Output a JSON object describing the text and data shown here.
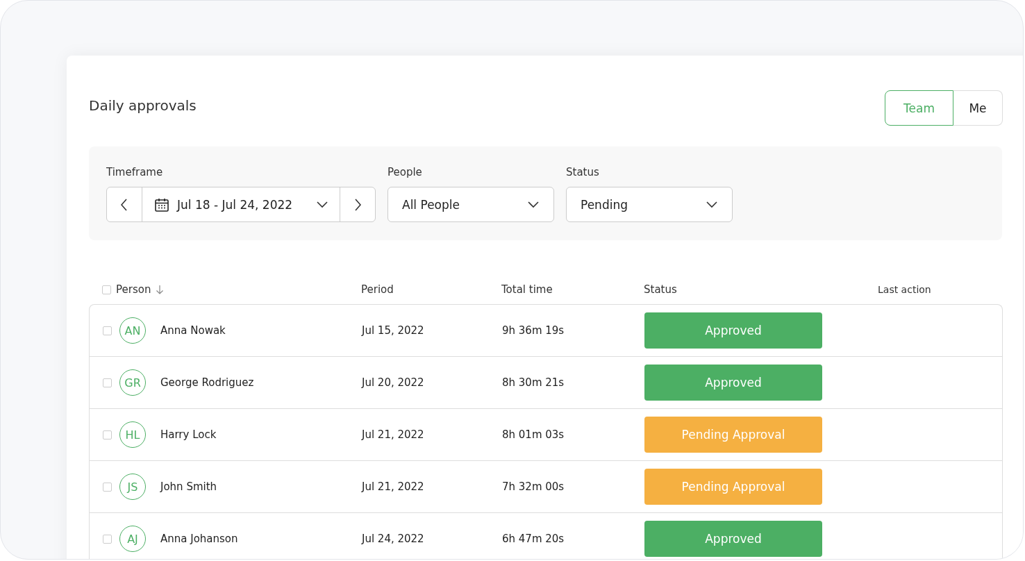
{
  "title": "Daily approvals",
  "view_toggle": [
    {
      "label": "Team",
      "selected": true
    },
    {
      "label": "Me",
      "selected": false
    }
  ],
  "filters": {
    "timeframe": {
      "label": "Timeframe",
      "value": "Jul 18 - Jul 24, 2022"
    },
    "people": {
      "label": "People",
      "value": "All People"
    },
    "status": {
      "label": "Status",
      "value": "Pending"
    }
  },
  "table": {
    "select_all_checked": false,
    "columns": [
      "Person",
      "Period",
      "Total time",
      "Status",
      "Last action"
    ],
    "rows": [
      {
        "checked": false,
        "initials": "AN",
        "person": "Anna Nowak",
        "period": "Jul 15, 2022",
        "total_time": "9h 36m 19s",
        "status": {
          "kind": "approved",
          "label": "Approved"
        }
      },
      {
        "checked": false,
        "initials": "GR",
        "person": "George Rodriguez",
        "period": "Jul 20, 2022",
        "total_time": "8h 30m 21s",
        "status": {
          "kind": "approved",
          "label": "Approved"
        }
      },
      {
        "checked": false,
        "initials": "HL",
        "person": "Harry Lock",
        "period": "Jul 21, 2022",
        "total_time": "8h 01m 03s",
        "status": {
          "kind": "pending",
          "label": "Pending Approval"
        }
      },
      {
        "checked": false,
        "initials": "JS",
        "person": "John Smith",
        "period": "Jul 21, 2022",
        "total_time": "7h 32m 00s",
        "status": {
          "kind": "pending",
          "label": "Pending Approval"
        }
      },
      {
        "checked": false,
        "initials": "AJ",
        "person": "Anna Johanson",
        "period": "Jul 24, 2022",
        "total_time": "6h 47m 20s",
        "status": {
          "kind": "approved",
          "label": "Approved"
        }
      }
    ]
  }
}
